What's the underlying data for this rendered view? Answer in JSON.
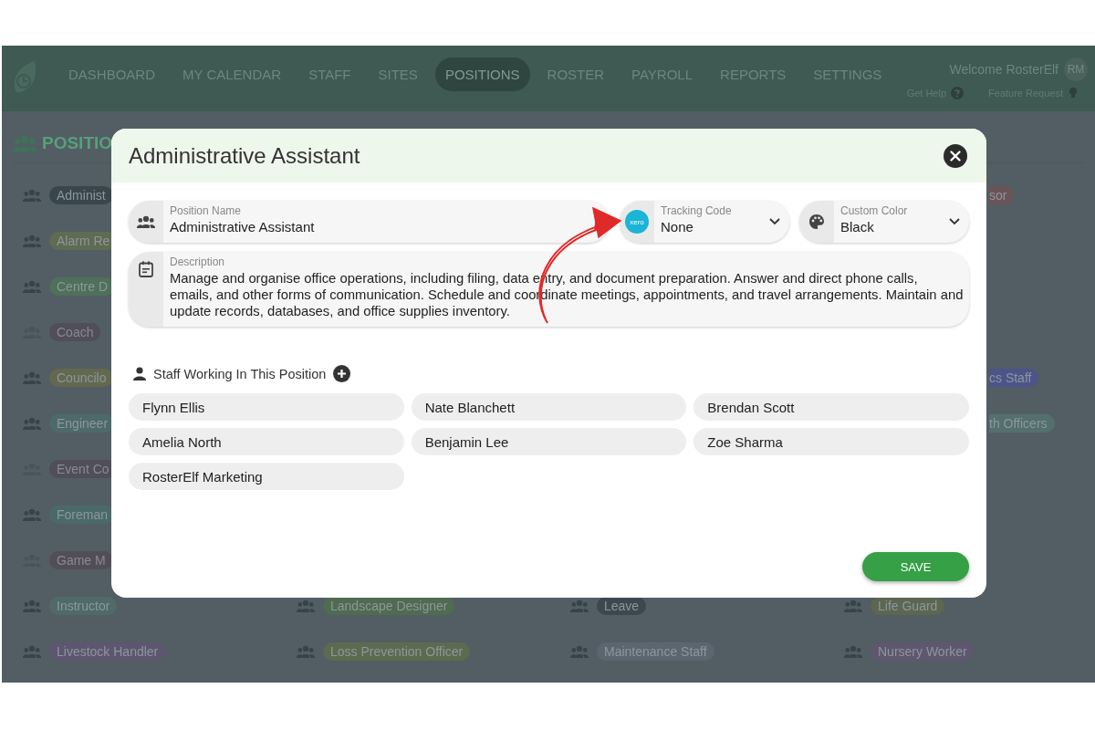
{
  "nav": {
    "items": [
      {
        "label": "DASHBOARD",
        "selected": false
      },
      {
        "label": "MY CALENDAR",
        "selected": false
      },
      {
        "label": "STAFF",
        "selected": false
      },
      {
        "label": "SITES",
        "selected": false
      },
      {
        "label": "POSITIONS",
        "selected": true
      },
      {
        "label": "ROSTER",
        "selected": false
      },
      {
        "label": "PAYROLL",
        "selected": false
      },
      {
        "label": "REPORTS",
        "selected": false
      },
      {
        "label": "SETTINGS",
        "selected": false
      }
    ],
    "welcome": "Welcome RosterElf",
    "avatar": "RM",
    "help": "Get Help",
    "feature_request": "Feature Request"
  },
  "page_title": "POSITIO",
  "position_rows": [
    {
      "cells": [
        {
          "kind": "full",
          "label": "Administ",
          "color": "#39464c",
          "faded": false
        },
        {
          "kind": "cut",
          "label": "sor",
          "color": "#6a5458",
          "faded": false
        }
      ]
    },
    {
      "cells": [
        {
          "kind": "full",
          "label": "Alarm Re",
          "color": "#5f6b52",
          "faded": false
        }
      ]
    },
    {
      "cells": [
        {
          "kind": "full",
          "label": "Centre D",
          "color": "#4f7059",
          "faded": false
        }
      ]
    },
    {
      "cells": [
        {
          "kind": "full",
          "label": "Coach",
          "color": "#504e58",
          "faded": true
        }
      ]
    },
    {
      "cells": [
        {
          "kind": "full",
          "label": "Councilo",
          "color": "#63684f",
          "faded": false
        },
        {
          "kind": "cut",
          "label": "cs Staff",
          "color": "#4c5489",
          "faded": false
        }
      ]
    },
    {
      "cells": [
        {
          "kind": "full",
          "label": "Engineer",
          "color": "#4d6a6b",
          "faded": false
        },
        {
          "kind": "cut",
          "label": "th Officers",
          "color": "#54706c",
          "faded": false
        }
      ]
    },
    {
      "cells": [
        {
          "kind": "full",
          "label": "Event Co",
          "color": "#4f4e5a",
          "faded": true
        }
      ]
    },
    {
      "cells": [
        {
          "kind": "full",
          "label": "Foreman",
          "color": "#4a6a69",
          "faded": false
        }
      ]
    },
    {
      "cells": [
        {
          "kind": "full",
          "label": "Game M",
          "color": "#524e58",
          "faded": true
        }
      ]
    },
    {
      "cells": [
        {
          "kind": "full",
          "label": "Instructor",
          "color": "#4f6a68",
          "faded": false
        },
        {
          "kind": "full",
          "label": "Landscape Designer",
          "color": "#4f6b50",
          "faded": false
        },
        {
          "kind": "full",
          "label": "Leave",
          "color": "#3c484d",
          "faded": false
        },
        {
          "kind": "full",
          "label": "Life Guard",
          "color": "#5d6650",
          "faded": false
        }
      ]
    },
    {
      "cells": [
        {
          "kind": "full",
          "label": "Livestock Handler",
          "color": "#5e5570",
          "faded": false
        },
        {
          "kind": "full",
          "label": "Loss Prevention Officer",
          "color": "#5c6b4f",
          "faded": false
        },
        {
          "kind": "full",
          "label": "Maintenance Staff",
          "color": "#5b6670",
          "faded": false
        },
        {
          "kind": "full",
          "label": "Nursery Worker",
          "color": "#5f5670",
          "faded": false
        }
      ]
    }
  ],
  "dialog": {
    "title": "Administrative Assistant",
    "position_name": {
      "label": "Position Name",
      "value": "Administrative Assistant"
    },
    "tracking_code": {
      "label": "Tracking Code",
      "value": "None",
      "logo_text": "xero"
    },
    "custom_color": {
      "label": "Custom Color",
      "value": "Black"
    },
    "description": {
      "label": "Description",
      "value": "Manage and organise office operations, including filing, data entry, and document preparation. Answer and direct phone calls, emails, and other forms of communication. Schedule and coordinate meetings, appointments, and travel arrangements. Maintain and update records, databases, and office supplies inventory."
    },
    "staff_heading": "Staff Working In This Position",
    "staff": [
      "Flynn Ellis",
      "Nate Blanchett",
      "Brendan Scott",
      "Amelia North",
      "Benjamin Lee",
      "Zoe Sharma",
      "RosterElf Marketing"
    ],
    "save": "SAVE"
  }
}
